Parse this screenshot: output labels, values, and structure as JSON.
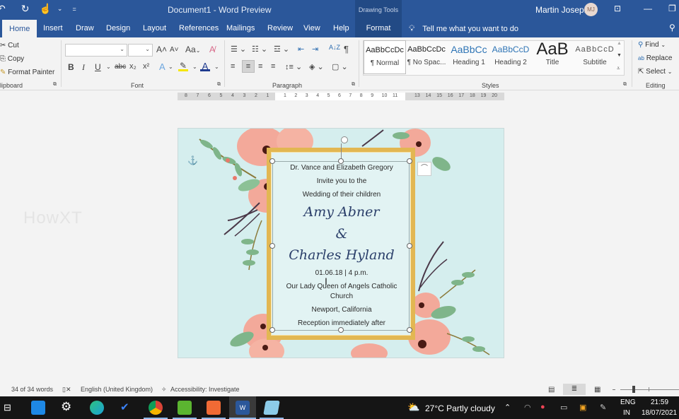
{
  "titlebar": {
    "title": "Document1  -  Word Preview",
    "context_group": "Drawing Tools",
    "user_name": "Martin Joseph",
    "user_initials": "MJ",
    "qat": {
      "undo": "↶",
      "redo": "↻",
      "touch": "☝",
      "more": "⌄",
      "customize": "="
    }
  },
  "tabs": [
    "Home",
    "Insert",
    "Draw",
    "Design",
    "Layout",
    "References",
    "Mailings",
    "Review",
    "View",
    "Help",
    "Format"
  ],
  "active_tab": "Home",
  "tell_me": "Tell me what you want to do",
  "ribbon": {
    "clipboard": {
      "cut": "Cut",
      "copy": "Copy",
      "format_painter": "Format Painter",
      "label": "lipboard"
    },
    "font": {
      "font_name": "",
      "font_size": "",
      "label": "Font",
      "bold": "B",
      "italic": "I",
      "underline": "U",
      "strike": "abc",
      "subscript": "x₂",
      "superscript": "x²",
      "grow": "A˄",
      "shrink": "A˅",
      "case": "Aa",
      "highlight_color": "#f5e600",
      "font_color": "#1f3b8f"
    },
    "paragraph": {
      "label": "Paragraph",
      "sort": "A↓Z",
      "pilcrow": "¶"
    },
    "styles": {
      "label": "Styles",
      "items": [
        {
          "preview": "AaBbCcDc",
          "name": "¶ Normal"
        },
        {
          "preview": "AaBbCcDc",
          "name": "¶ No Spac..."
        },
        {
          "preview": "AaBbCc",
          "name": "Heading 1"
        },
        {
          "preview": "AaBbCcD",
          "name": "Heading 2"
        },
        {
          "preview": "AaB",
          "name": "Title"
        },
        {
          "preview": "AaBbCcD",
          "name": "Subtitle"
        }
      ]
    },
    "editing": {
      "find": "Find",
      "replace": "Replace",
      "select": "Select",
      "label": "Editing"
    }
  },
  "ruler": {
    "left": [
      "8",
      "7",
      "6",
      "5",
      "4",
      "3",
      "2",
      "1"
    ],
    "middle": [
      "1",
      "2",
      "3",
      "4",
      "5",
      "6",
      "7",
      "8",
      "9",
      "10",
      "11"
    ],
    "right": [
      "13",
      "14",
      "15",
      "16",
      "17",
      "18",
      "19",
      "20"
    ]
  },
  "document": {
    "lines": [
      "Dr. Vance and Elizabeth Gregory",
      "Invite you to the",
      "Wedding of their children",
      "Amy Abner",
      "&",
      "Charles Hyland",
      "01.06.18 | 4 p.m.",
      "Our Lady Queen of Angels Catholic",
      "Church",
      "Newport, California",
      "Reception immediately after"
    ]
  },
  "watermark": "HowXT",
  "statusbar": {
    "words": "34 of 34 words",
    "language": "English (United Kingdom)",
    "accessibility": "Accessibility: Investigate"
  },
  "taskbar": {
    "weather": "27°C  Partly cloudy",
    "lang_top": "ENG",
    "lang_bottom": "IN",
    "time": "21:59",
    "date": "18/07/2021",
    "apps": [
      {
        "name": "task-view",
        "color": "#151515"
      },
      {
        "name": "mail",
        "color": "#1e88e5"
      },
      {
        "name": "settings",
        "color": "#151515"
      },
      {
        "name": "edge",
        "color": "#1aa1d6"
      },
      {
        "name": "todo",
        "color": "#151515"
      },
      {
        "name": "chrome",
        "color": "#db4437"
      },
      {
        "name": "camtasia",
        "color": "#5bb530"
      },
      {
        "name": "snagit",
        "color": "#f06a35"
      },
      {
        "name": "word",
        "color": "#2b579a"
      },
      {
        "name": "notepad",
        "color": "#8ccbe8"
      }
    ]
  }
}
